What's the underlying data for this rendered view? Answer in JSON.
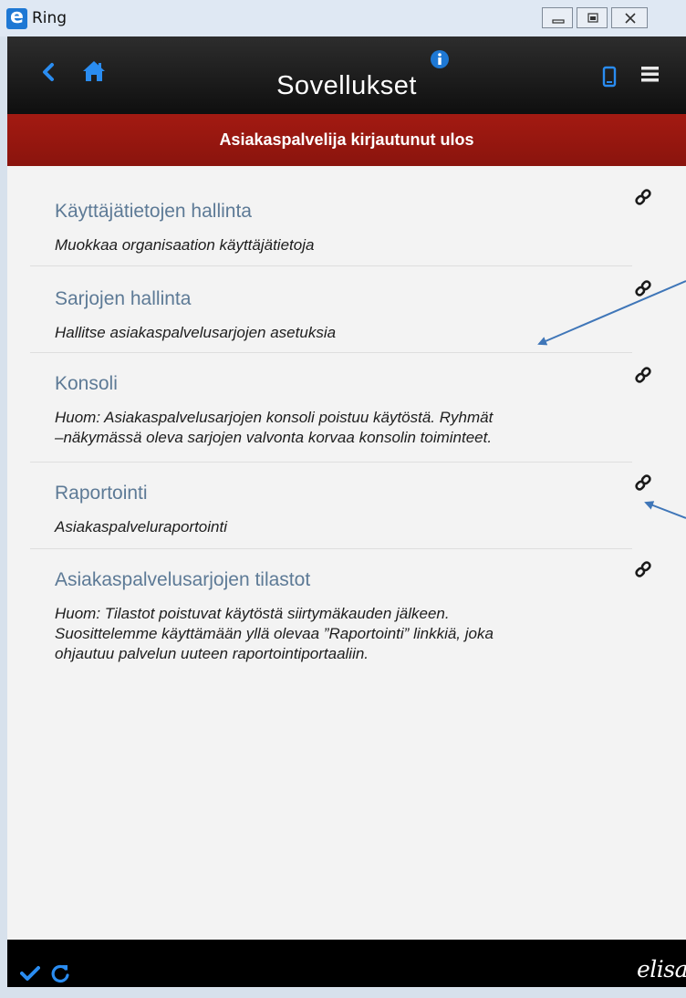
{
  "window": {
    "title": "Ring",
    "logo_letter": "e"
  },
  "header": {
    "title": "Sovellukset",
    "icons": [
      "back-icon",
      "home-icon",
      "info-icon",
      "device-icon",
      "menu-icon"
    ]
  },
  "banner": {
    "text": "Asiakaspalvelija kirjautunut ulos",
    "color": "#a31a12"
  },
  "items": [
    {
      "title": "Käyttäjätietojen hallinta",
      "desc_lines": [
        "Muokkaa organisaation käyttäjätietoja"
      ]
    },
    {
      "title": "Sarjojen hallinta",
      "desc_lines": [
        "Hallitse asiakaspalvelusarjojen asetuksia"
      ]
    },
    {
      "title": "Konsoli",
      "desc_lines": [
        "Huom: Asiakaspalvelusarjojen konsoli poistuu käytöstä. Ryhmät",
        "–näkymässä oleva sarjojen valvonta korvaa konsolin toiminteet."
      ]
    },
    {
      "title": "Raportointi",
      "desc_lines": [
        "Asiakaspalveluraportointi"
      ]
    },
    {
      "title": "Asiakaspalvelusarjojen tilastot",
      "desc_lines": [
        "Huom: Tilastot poistuvat käytöstä siirtymäkauden jälkeen.",
        "Suosittelemme käyttämään yllä olevaa ”Raportointi” linkkiä, joka",
        "ohjautuu palvelun uuteen raportointiportaaliin."
      ]
    }
  ],
  "footer": {
    "brand": "elisa",
    "icons": [
      "check-icon",
      "refresh-icon"
    ]
  },
  "colors": {
    "accent": "#1e78d4",
    "title_text": "#5d7a96",
    "annotation_arrow": "#3f76b8"
  }
}
